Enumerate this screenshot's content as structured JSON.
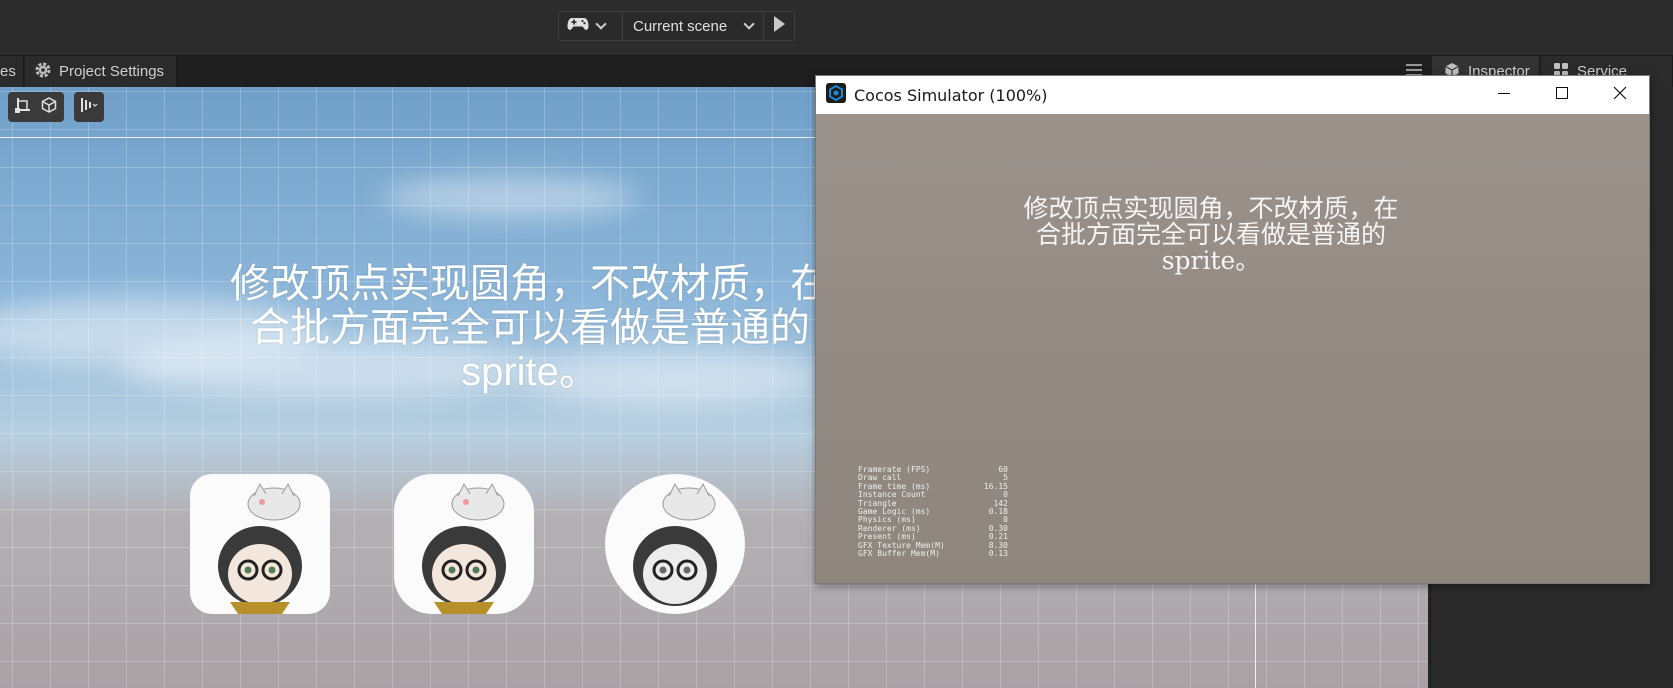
{
  "toolbar": {
    "scene_select": "Current scene",
    "icons": [
      "gamepad-icon",
      "chevron-down-icon",
      "play-icon"
    ]
  },
  "tabs": {
    "left_partial": "es",
    "project_settings": "Project Settings",
    "inspector": "Inspector",
    "service": "Service"
  },
  "scene": {
    "label_text": "修改顶点实现圆角，不改材质，在\n合批方面完全可以看做是普通的\nsprite。",
    "sprites": [
      "rounded-corner-sprite",
      "large-rounded-corner-sprite",
      "circle-sprite"
    ]
  },
  "simulator": {
    "title": "Cocos Simulator (100%)",
    "label_text": "修改顶点实现圆角，不改材质，在\n合批方面完全可以看做是普通的\nsprite。",
    "stats": [
      {
        "label": "Framerate (FPS)",
        "value": "60"
      },
      {
        "label": "Draw call",
        "value": "5"
      },
      {
        "label": "Frame time (ms)",
        "value": "16.15"
      },
      {
        "label": "Instance Count",
        "value": "0"
      },
      {
        "label": "Triangle",
        "value": "142"
      },
      {
        "label": "Game Logic (ms)",
        "value": "0.18"
      },
      {
        "label": "Physics (ms)",
        "value": "0"
      },
      {
        "label": "Renderer (ms)",
        "value": "0.30"
      },
      {
        "label": "Present (ms)",
        "value": "0.21"
      },
      {
        "label": "GFX Texture Mem(M)",
        "value": "8.30"
      },
      {
        "label": "GFX Buffer Mem(M)",
        "value": "0.13"
      }
    ]
  },
  "colors": {
    "editor_bg": "#262626",
    "toolbar_bg": "#2c2c2c",
    "sky_top": "#6f9fc8",
    "sim_bg": "#928a82",
    "cocos_blue": "#1e88d6"
  }
}
